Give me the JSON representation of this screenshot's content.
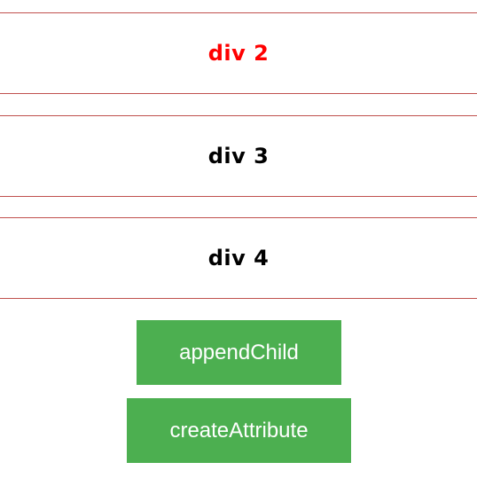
{
  "boxes": [
    {
      "label": "div 2",
      "color": "#ff0000"
    },
    {
      "label": "div 3",
      "color": "#000000"
    },
    {
      "label": "div 4",
      "color": "#000000"
    }
  ],
  "border_color": "#c0504d",
  "buttons": {
    "append_label": "appendChild",
    "create_label": "createAttribute",
    "background": "#4caf50",
    "text_color": "#ffffff"
  }
}
